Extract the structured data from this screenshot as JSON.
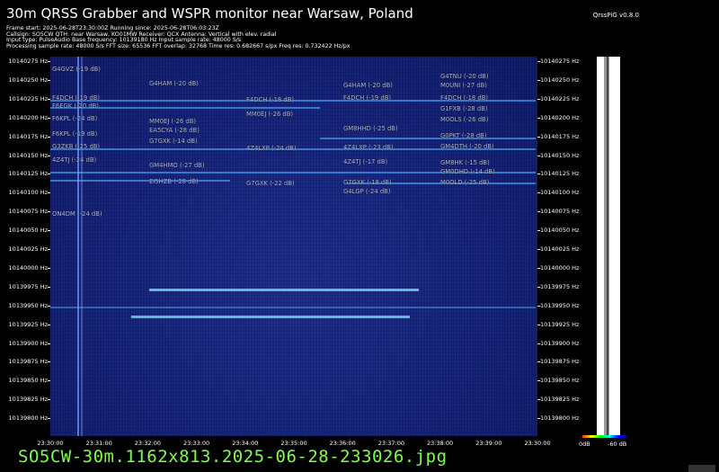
{
  "title": "30m QRSS Grabber and WSPR monitor near Warsaw, Poland",
  "app_version": "QrssPiG v0.8.0",
  "info_lines": [
    "Frame start: 2025-06-28T23:30:00Z Running since: 2025-06-28T06:03:23Z",
    "Callsign: SO5CW QTH: near Warsaw, KO01MW Receiver: QCX Antenna: Vertical with elev. radial",
    "Input type: PulseAudio Base frequency: 10139180 Hz Input sample rate: 48000 S/s",
    "Processing sample rate: 48000 S/s FFT size: 65536 FFT overlap: 32768 Time res: 0.682667 s/px Freq res: 0.732422 Hz/px"
  ],
  "y_ticks": [
    "10140275 Hz",
    "10140250 Hz",
    "10140225 Hz",
    "10140200 Hz",
    "10140175 Hz",
    "10140150 Hz",
    "10140125 Hz",
    "10140100 Hz",
    "10140075 Hz",
    "10140050 Hz",
    "10140025 Hz",
    "10140000 Hz",
    "10139975 Hz",
    "10139950 Hz",
    "10139925 Hz",
    "10139900 Hz",
    "10139875 Hz",
    "10139850 Hz",
    "10139825 Hz",
    "10139800 Hz"
  ],
  "x_ticks": [
    "23:30:00",
    "23:31:00",
    "23:32:00",
    "23:33:00",
    "23:34:00",
    "23:35:00",
    "23:36:00",
    "23:37:00",
    "23:38:00",
    "23:39:00",
    "23:30:00"
  ],
  "colorbar_labels": {
    "left": "0dB",
    "right": "-60 dB"
  },
  "spots": [
    {
      "text": "G4GVZ (-19 dB)"
    },
    {
      "text": "F4DCH (-19 dB)"
    },
    {
      "text": "F6EGK (-20 dB)"
    },
    {
      "text": "F6KPL (-24 dB)"
    },
    {
      "text": "F6KPL (-19 dB)"
    },
    {
      "text": "G3ZKB (-25 dB)"
    },
    {
      "text": "4Z4TJ (-24 dB)"
    },
    {
      "text": "ON4DM (-24 dB)"
    },
    {
      "text": "G4HAM (-20 dB)"
    },
    {
      "text": "MM0EJ (-26 dB)"
    },
    {
      "text": "EA5CYA (-28 dB)"
    },
    {
      "text": "G7GXK (-14 dB)"
    },
    {
      "text": "GM4HMO (-27 dB)"
    },
    {
      "text": "EI5HZB (-28 dB)"
    },
    {
      "text": "4Z4LXP (-24 dB)"
    },
    {
      "text": "F4DCH (-18 dB)"
    },
    {
      "text": "G7GXK (-22 dB)"
    },
    {
      "text": "MM0EJ (-26 dB)"
    },
    {
      "text": "G4HAM (-20 dB)"
    },
    {
      "text": "F4DCH (-19 dB)"
    },
    {
      "text": "GM8HHD (-25 dB)"
    },
    {
      "text": "4Z4LXP (-23 dB)"
    },
    {
      "text": "4Z4TJ (-17 dB)"
    },
    {
      "text": "G7GXK (-18 dB)"
    },
    {
      "text": "G4LGP (-24 dB)"
    },
    {
      "text": "G4TNU (-20 dB)"
    },
    {
      "text": "M0UNI (-27 dB)"
    },
    {
      "text": "F4DCH (-18 dB)"
    },
    {
      "text": "G1FXB (-28 dB)"
    },
    {
      "text": "M0OLS (-26 dB)"
    },
    {
      "text": "G0PKT (-28 dB)"
    },
    {
      "text": "GM4DTH (-20 dB)"
    },
    {
      "text": "GM8HK (-15 dB)"
    },
    {
      "text": "GM0DHD (-14 dB)"
    },
    {
      "text": "M0OLD (-25 dB)"
    }
  ],
  "filename": "SO5CW-30m.1162x813.2025-06-28-233026.jpg"
}
